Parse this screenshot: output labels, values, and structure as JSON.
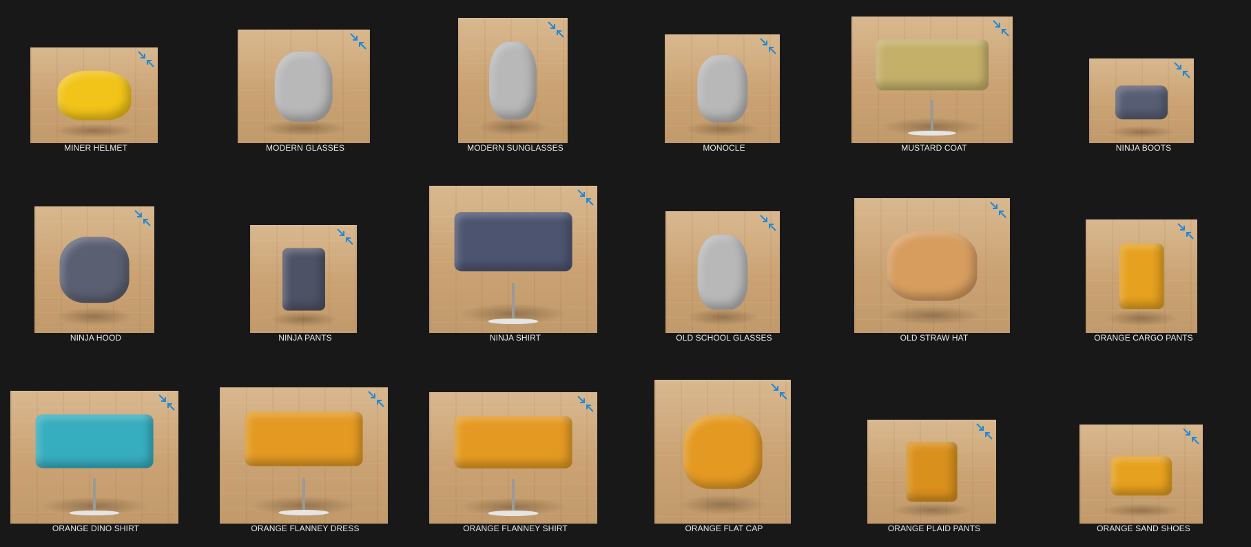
{
  "items": [
    {
      "name": "MINER HELMET",
      "color": "#f2c318",
      "icon": "hat-icon"
    },
    {
      "name": "MODERN GLASSES",
      "color": "#b8b8b8",
      "icon": "glasses-icon"
    },
    {
      "name": "MODERN SUNGLASSES",
      "color": "#b8b8b8",
      "icon": "glasses-icon"
    },
    {
      "name": "MONOCLE",
      "color": "#b8b8b8",
      "icon": "glasses-icon"
    },
    {
      "name": "MUSTARD COAT",
      "color": "#c5b06a",
      "icon": "shirt-icon"
    },
    {
      "name": "NINJA BOOTS",
      "color": "#575d73",
      "icon": "shoes-icon"
    },
    {
      "name": "NINJA HOOD",
      "color": "#5a5f72",
      "icon": "hat-icon"
    },
    {
      "name": "NINJA PANTS",
      "color": "#4e5266",
      "icon": "pants-icon"
    },
    {
      "name": "NINJA SHIRT",
      "color": "#4c5470",
      "icon": "shirt-icon"
    },
    {
      "name": "OLD SCHOOL GLASSES",
      "color": "#b8b8b8",
      "icon": "glasses-icon"
    },
    {
      "name": "OLD STRAW HAT",
      "color": "#d79d5f",
      "icon": "hat-icon"
    },
    {
      "name": "ORANGE CARGO PANTS",
      "color": "#e6a11e",
      "icon": "pants-icon"
    },
    {
      "name": "ORANGE DINO SHIRT",
      "color": "#37aebf",
      "icon": "shirt-icon"
    },
    {
      "name": "ORANGE FLANNEY DRESS",
      "color": "#e49a22",
      "icon": "shirt-icon"
    },
    {
      "name": "ORANGE FLANNEY SHIRT",
      "color": "#e49a22",
      "icon": "shirt-icon"
    },
    {
      "name": "ORANGE FLAT CAP",
      "color": "#e49a22",
      "icon": "hat-icon"
    },
    {
      "name": "ORANGE PLAID PANTS",
      "color": "#d9901c",
      "icon": "pants-icon"
    },
    {
      "name": "ORANGE SAND SHOES",
      "color": "#e6a11e",
      "icon": "shoes-icon"
    }
  ],
  "badge_icon": "collapse-arrows-icon",
  "badge_color": "#1e88d8",
  "background_color": "#181818"
}
